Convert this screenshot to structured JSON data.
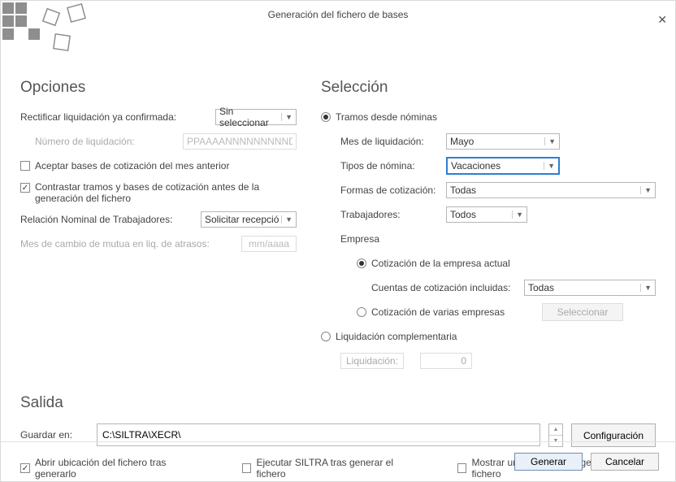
{
  "window": {
    "title": "Generación del fichero de bases"
  },
  "opciones": {
    "heading": "Opciones",
    "rectificar_label": "Rectificar liquidación ya confirmada:",
    "rectificar_value": "Sin seleccionar",
    "numero_liquidacion_label": "Número de liquidación:",
    "numero_liquidacion_placeholder": "PPAAAANNNNNNNNNDC",
    "aceptar_bases_label": "Aceptar bases de cotización del mes anterior",
    "contrastar_label": "Contrastar tramos y bases de cotización antes de la generación del fichero",
    "relacion_label": "Relación Nominal de Trabajadores:",
    "relacion_value": "Solicitar recepció",
    "mes_cambio_label": "Mes de cambio de mutua en liq. de atrasos:",
    "mes_cambio_placeholder": "mm/aaaa"
  },
  "seleccion": {
    "heading": "Selección",
    "tramos_label": "Tramos desde nóminas",
    "mes_liq_label": "Mes de liquidación:",
    "mes_liq_value": "Mayo",
    "tipos_nomina_label": "Tipos de nómina:",
    "tipos_nomina_value": "Vacaciones",
    "formas_label": "Formas de cotización:",
    "formas_value": "Todas",
    "trabajadores_label": "Trabajadores:",
    "trabajadores_value": "Todos",
    "empresa_label": "Empresa",
    "cot_actual_label": "Cotización de la empresa actual",
    "cuentas_label": "Cuentas de cotización incluidas:",
    "cuentas_value": "Todas",
    "cot_varias_label": "Cotización de varias empresas",
    "seleccionar_btn": "Seleccionar",
    "liq_compl_label": "Liquidación complementaria",
    "liq_label": "Liquidación:",
    "liq_value": "0"
  },
  "salida": {
    "heading": "Salida",
    "guardar_label": "Guardar en:",
    "guardar_value": "C:\\SILTRA\\XECR\\",
    "config_btn": "Configuración",
    "abrir_label": "Abrir ubicación del fichero tras generarlo",
    "ejecutar_label": "Ejecutar SILTRA tras generar el fichero",
    "mostrar_label": "Mostrar un resumen tras generar el fichero"
  },
  "footer": {
    "generar": "Generar",
    "cancelar": "Cancelar"
  }
}
